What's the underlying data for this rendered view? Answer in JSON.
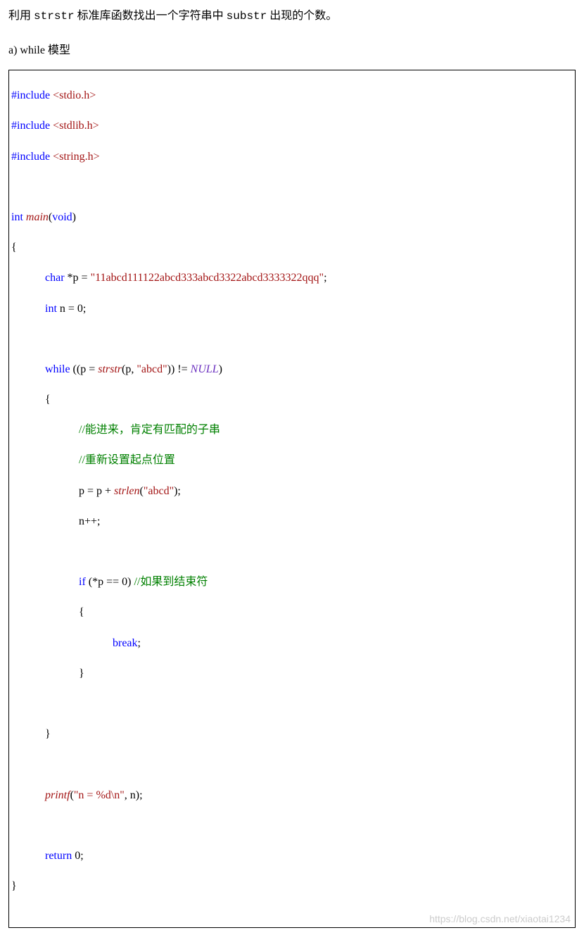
{
  "intro": {
    "prefix": "利用",
    "code1": "strstr",
    "mid": "标准库函数找出一个字符串中",
    "code2": "substr",
    "suffix": "出现的个数。"
  },
  "section_label": "a) while 模型",
  "code": {
    "inc1_kw": "#include",
    "inc1_path": "<stdio.h>",
    "inc2_kw": "#include",
    "inc2_path": "<stdlib.h>",
    "inc3_kw": "#include",
    "inc3_path": "<string.h>",
    "int_kw": "int ",
    "main_fn": "main",
    "main_sig_open": "(",
    "void_kw": "void",
    "main_sig_close": ")",
    "lbrace": "{",
    "decl_indent": "            ",
    "char_kw": "char",
    "decl_p": " *p = ",
    "p_str": "\"11abcd111122abcd333abcd3322abcd3333322qqq\"",
    "semi": ";",
    "int_n": "int",
    "n_decl": " n = ",
    "zero": "0",
    "while_kw": "while",
    "while_open": " ((p = ",
    "strstr_fn": "strstr",
    "strstr_args_open": "(p, ",
    "abcd_str": "\"abcd\"",
    "strstr_args_close": ")) != ",
    "null_kw": "NULL",
    "while_close": ")",
    "inner_indent": "                        ",
    "cmt1": "//能进来，肯定有匹配的子串",
    "cmt2": "//重新设置起点位置",
    "p_assign": "p = p + ",
    "strlen_fn": "strlen",
    "strlen_open": "(",
    "strlen_close": ")",
    "npp": "n++;",
    "if_kw": "if",
    "if_cond_open": " (*p == ",
    "if_cond_close": ") ",
    "cmt3": "//如果到结束符",
    "break_indent": "                                    ",
    "break_kw": "break",
    "inner_lbrace": "{",
    "inner_rbrace": "}",
    "printf_fn": "printf",
    "printf_open": "(",
    "printf_str": "\"n = %d\\n\"",
    "printf_rest": ", n);",
    "return_kw": "return",
    "return_rest": " ",
    "rbrace": "}"
  },
  "watermark": "https://blog.csdn.net/xiaotai1234"
}
